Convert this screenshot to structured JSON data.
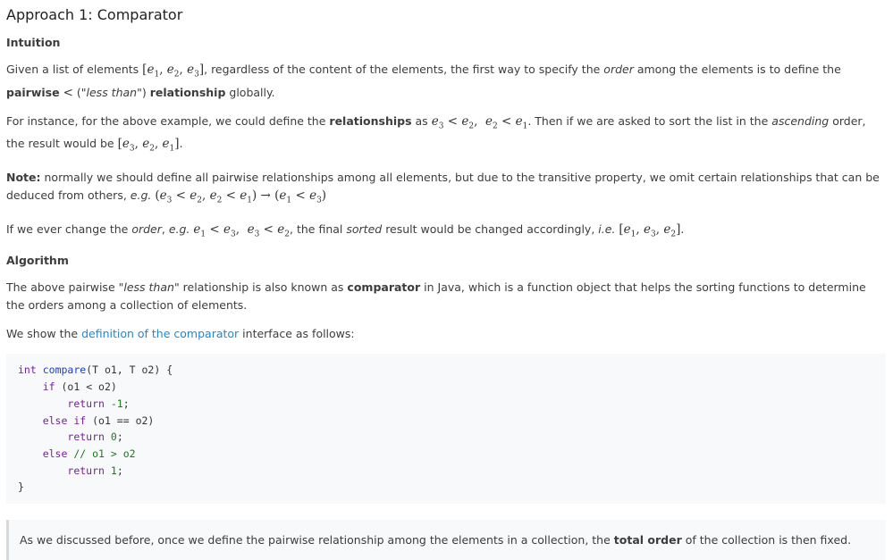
{
  "title": "Approach 1: Comparator",
  "sections": {
    "intuition_heading": "Intuition",
    "algorithm_heading": "Algorithm"
  },
  "p1": {
    "t1": "Given a list of elements",
    "t2": ", regardless of the content of the elements, the first way to specify the",
    "order": "order",
    "t3": "among the elements is to define the",
    "pairwise": "pairwise",
    "t4": "(\"",
    "less_than": "less than",
    "t5": "\")",
    "relationship": "relationship",
    "t6": "globally."
  },
  "p2": {
    "t1": "For instance, for the above example, we could define the",
    "relationships": "relationships",
    "t2": "as",
    "t3": ". Then if we are asked to sort the list in the",
    "ascending": "ascending",
    "t4": "order, the result would be",
    "t5": "."
  },
  "p3": {
    "note": "Note:",
    "t1": "normally we should define all pairwise relationships among all elements, but due to the transitive property, we omit certain relationships that can be deduced from others,",
    "eg": "e.g."
  },
  "p4": {
    "t1": "If we ever change the",
    "order": "order",
    "eg": "e.g.",
    "t2": ", the final",
    "sorted": "sorted",
    "t3": "result would be changed accordingly,",
    "ie": "i.e.",
    "t4": "."
  },
  "p5": {
    "t1": "The above pairwise \"",
    "less_than": "less than",
    "t2": "\" relationship is also known as",
    "comparator": "comparator",
    "t3": "in Java, which is a function object that helps the sorting functions to determine the orders among a collection of elements."
  },
  "p6": {
    "t1": "We show the",
    "link": "definition of the comparator",
    "t2": "interface as follows:"
  },
  "code": {
    "l1_kw": "int",
    "l1_fn": "compare",
    "l1_rest": "(T o1, T o2) {",
    "l2_kw": "if",
    "l2_rest": "(o1 < o2)",
    "l3_kw": "return",
    "l3_num": "-1",
    "l4_kw": "else if",
    "l4_rest": "(o1 == o2)",
    "l5_kw": "return",
    "l5_num": "0",
    "l6_kw": "else",
    "l6_comment": "// o1 > o2",
    "l7_kw": "return",
    "l7_num": "1",
    "semicolon": ";",
    "close": "}"
  },
  "quote": {
    "t1": "As we discussed before, once we define the pairwise relationship among the elements in a collection, the",
    "total_order": "total order",
    "t2": "of the collection is then fixed."
  }
}
